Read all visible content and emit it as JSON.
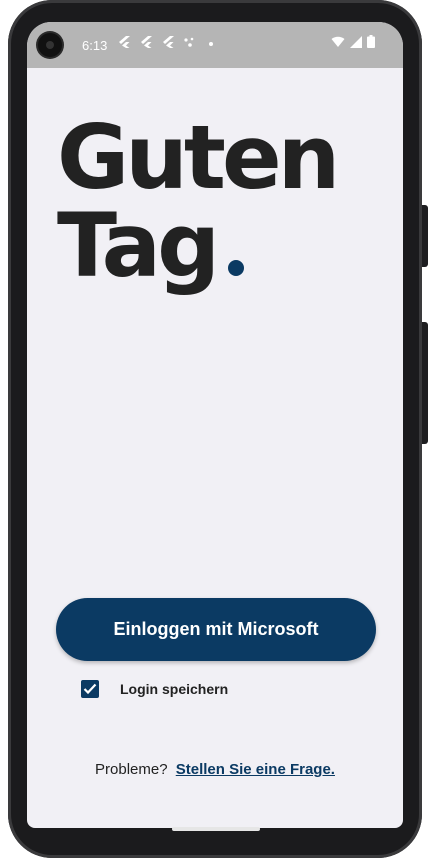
{
  "statusbar": {
    "time": "6:13",
    "notification_icons": [
      "flutter-icon",
      "flutter-icon",
      "flutter-icon",
      "assistant-dots-icon",
      "dot-icon"
    ],
    "system_icons": [
      "wifi-icon",
      "signal-icon",
      "battery-icon"
    ]
  },
  "greeting": {
    "line1": "Guten",
    "line2": "Tag",
    "accent_color": "#0b3a63"
  },
  "login": {
    "button_label": "Einloggen mit Microsoft",
    "button_color": "#0b3a63",
    "remember_label": "Login speichern",
    "remember_checked": true
  },
  "help": {
    "prefix": "Probleme?",
    "link_label": "Stellen Sie eine Frage."
  }
}
